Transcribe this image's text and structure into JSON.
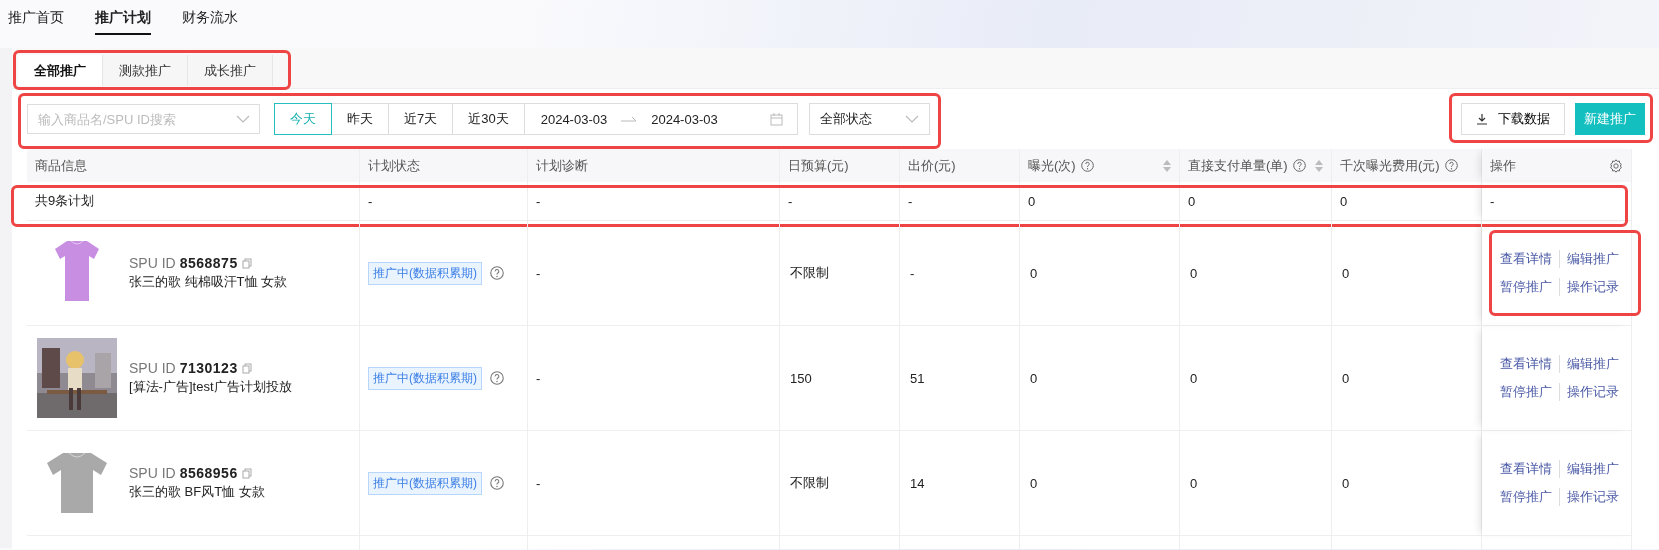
{
  "nav_tabs": [
    {
      "label": "推广首页",
      "selected": false
    },
    {
      "label": "推广计划",
      "selected": true
    },
    {
      "label": "财务流水",
      "selected": false
    }
  ],
  "plan_tabs": {
    "highlighted": true,
    "items": [
      {
        "label": "全部推广",
        "selected": true
      },
      {
        "label": "测款推广",
        "selected": false
      },
      {
        "label": "成长推广",
        "selected": false
      }
    ]
  },
  "filters": {
    "highlighted": true,
    "search": {
      "placeholder": "输入商品名/SPU ID搜索"
    },
    "date_presets": [
      {
        "label": "今天",
        "selected": true
      },
      {
        "label": "昨天",
        "selected": false
      },
      {
        "label": "近7天",
        "selected": false
      },
      {
        "label": "近30天",
        "selected": false
      }
    ],
    "date_range": {
      "start": "2024-03-03",
      "end": "2024-03-03"
    },
    "status": {
      "value": "全部状态"
    }
  },
  "actions": {
    "highlighted": true,
    "buttons": [
      {
        "label": "下载数据",
        "kind": "download"
      },
      {
        "label": "新建推广",
        "kind": "primary"
      }
    ]
  },
  "table": {
    "columns": [
      {
        "label": "商品信息",
        "help": false,
        "sortable": false,
        "settings": false
      },
      {
        "label": "计划状态",
        "help": false,
        "sortable": false,
        "settings": false
      },
      {
        "label": "计划诊断",
        "help": false,
        "sortable": false,
        "settings": false
      },
      {
        "label": "日预算(元)",
        "help": false,
        "sortable": false,
        "settings": false
      },
      {
        "label": "出价(元)",
        "help": false,
        "sortable": false,
        "settings": false
      },
      {
        "label": "曝光(次)",
        "help": true,
        "sortable": true,
        "settings": false
      },
      {
        "label": "直接支付单量(单)",
        "help": true,
        "sortable": true,
        "settings": false
      },
      {
        "label": "千次曝光费用(元)",
        "help": true,
        "sortable": false,
        "settings": false
      },
      {
        "label": "操作",
        "help": false,
        "sortable": false,
        "settings": true
      }
    ],
    "summary": {
      "highlighted": true,
      "cells": [
        "共9条计划",
        "-",
        "-",
        "-",
        "-",
        "0",
        "0",
        "0",
        "-"
      ]
    },
    "rows": [
      {
        "spu_label": "SPU ID",
        "spu_id": "8568875",
        "name": "张三的歌 纯棉吸汗T恤 女款",
        "status": "推广中(数据积累期)",
        "diagnosis": "-",
        "budget": "不限制",
        "bid": "-",
        "exposure": "0",
        "orders": "0",
        "cpm": "0",
        "actions": [
          "查看详情",
          "编辑推广",
          "暂停推广",
          "操作记录"
        ],
        "actions_highlighted": true
      },
      {
        "spu_label": "SPU ID",
        "spu_id": "7130123",
        "name": "[算法-广告]test广告计划投放",
        "status": "推广中(数据积累期)",
        "diagnosis": "-",
        "budget": "150",
        "bid": "51",
        "exposure": "0",
        "orders": "0",
        "cpm": "0",
        "actions": [
          "查看详情",
          "编辑推广",
          "暂停推广",
          "操作记录"
        ],
        "actions_highlighted": false
      },
      {
        "spu_label": "SPU ID",
        "spu_id": "8568956",
        "name": "张三的歌 BF风T恤 女款",
        "status": "推广中(数据积累期)",
        "diagnosis": "-",
        "budget": "不限制",
        "bid": "14",
        "exposure": "0",
        "orders": "0",
        "cpm": "0",
        "actions": [
          "查看详情",
          "编辑推广",
          "暂停推广",
          "操作记录"
        ],
        "actions_highlighted": false
      }
    ]
  }
}
